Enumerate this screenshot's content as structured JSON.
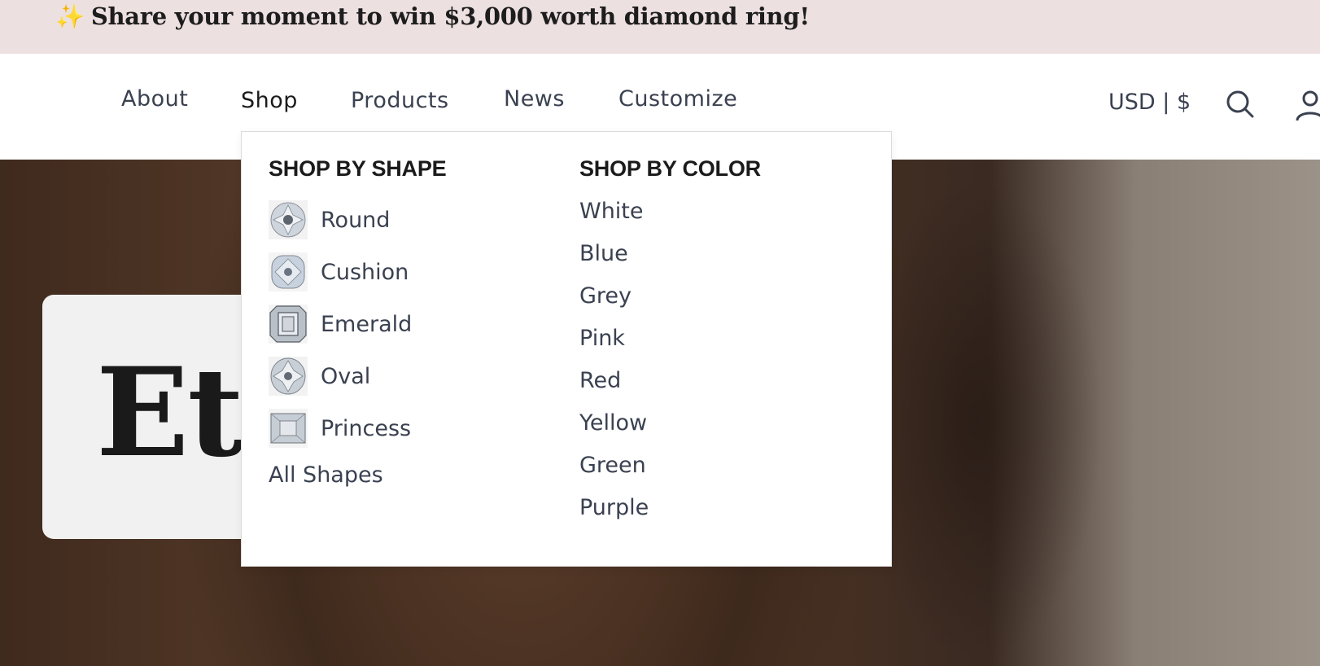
{
  "announcement": {
    "icon": "sparkles-icon",
    "text": "Share your moment to win $3,000 worth diamond ring!"
  },
  "nav": {
    "items": [
      {
        "label": "About"
      },
      {
        "label": "Shop"
      },
      {
        "label": "Products"
      },
      {
        "label": "News"
      },
      {
        "label": "Customize"
      }
    ],
    "active": "Shop",
    "currency": "USD | $",
    "icons": [
      "search-icon",
      "account-icon"
    ]
  },
  "dropdown": {
    "shape_heading": "SHOP BY SHAPE",
    "shapes": [
      {
        "label": "Round",
        "icon": "round-diamond-icon"
      },
      {
        "label": "Cushion",
        "icon": "cushion-diamond-icon"
      },
      {
        "label": "Emerald",
        "icon": "emerald-diamond-icon"
      },
      {
        "label": "Oval",
        "icon": "oval-diamond-icon"
      },
      {
        "label": "Princess",
        "icon": "princess-diamond-icon"
      }
    ],
    "all_shapes": "All Shapes",
    "color_heading": "SHOP BY COLOR",
    "colors": [
      "White",
      "Blue",
      "Grey",
      "Pink",
      "Red",
      "Yellow",
      "Green",
      "Purple"
    ]
  },
  "hero": {
    "title": "Ethical"
  },
  "colors": {
    "announcement_bg": "#ede0e0",
    "text": "#3a4150",
    "heading": "#1b1b1b"
  }
}
